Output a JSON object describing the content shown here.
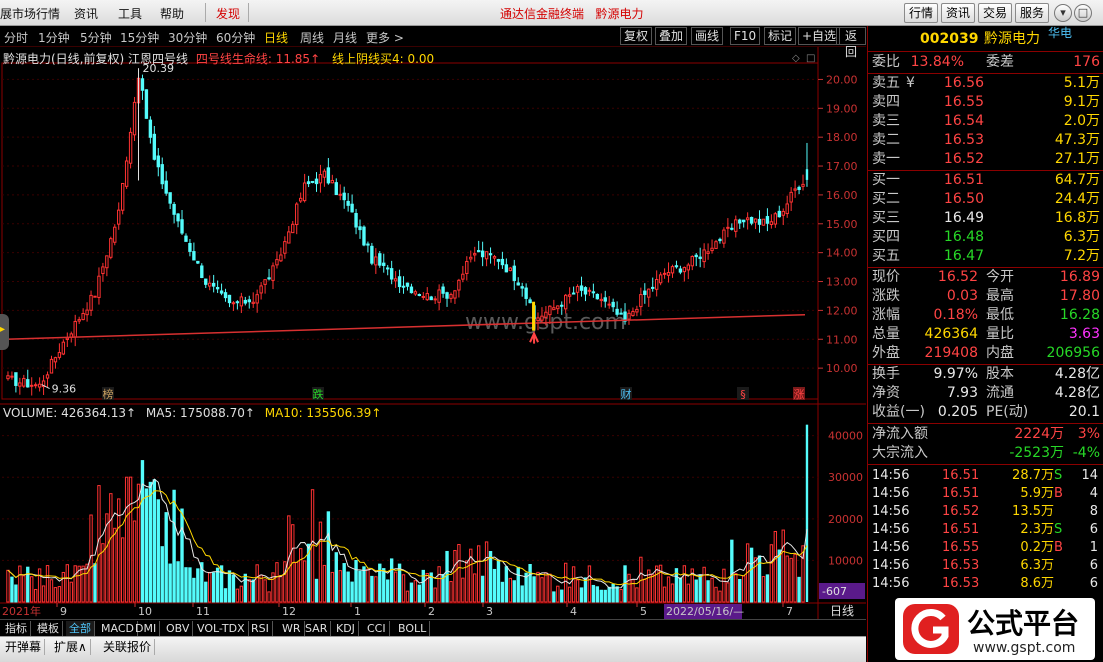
{
  "menu": {
    "items": [
      "展市场行情",
      "资讯",
      "工具",
      "帮助",
      "发现"
    ],
    "app_title": "通达信金融终端",
    "stock_title": "黔源电力",
    "right_buttons": [
      "行情",
      "资讯",
      "交易",
      "服务"
    ]
  },
  "periods": [
    "分时",
    "1分钟",
    "5分钟",
    "15分钟",
    "30分钟",
    "60分钟",
    "日线",
    "周线",
    "月线",
    "更多 >"
  ],
  "tools": [
    "复权",
    "叠加",
    "画线",
    "F10",
    "标记",
    "+自选",
    "返回"
  ],
  "main_info": {
    "title": "黔源电力(日线,前复权)",
    "indicator": "江恩四号线",
    "line1": "四号线生命线: 11.85↑",
    "line2": "线上阴线买4: 0.00"
  },
  "volume_info": {
    "vol": "VOLUME: 426364.13↑",
    "ma5": "MA5: 175088.70↑",
    "ma10": "MA10: 135506.39↑"
  },
  "price_axis": [
    "20.00",
    "19.00",
    "18.00",
    "17.00",
    "16.00",
    "15.00",
    "14.00",
    "13.00",
    "12.00",
    "11.00",
    "10.00"
  ],
  "volume_axis": [
    "40000",
    "30000",
    "20000",
    "10000"
  ],
  "annotations": {
    "high": "20.39",
    "low": "9.36",
    "events": [
      "榜",
      "跌",
      "财",
      "§",
      "涨"
    ],
    "watermark_text": "www.gspt.com"
  },
  "date_axis": {
    "labels": [
      "2021年",
      "9",
      "10",
      "11",
      "12",
      "1",
      "2",
      "3",
      "4",
      "5",
      "2022/05/16/—",
      "7"
    ],
    "period": "日线",
    "offset": "-607"
  },
  "chart_data": {
    "type": "candlestick",
    "ylim": [
      9.0,
      20.5
    ],
    "title": "黔源电力(日线,前复权)",
    "ma_line_name": "四号线生命线",
    "ma_line": {
      "start": 11.0,
      "end": 11.85
    },
    "high_mark": 20.39,
    "low_mark": 9.36,
    "volume_ylim": [
      0,
      44000
    ],
    "anchors": [
      [
        0,
        9.6
      ],
      [
        8,
        9.4
      ],
      [
        14,
        10.9
      ],
      [
        22,
        12.6
      ],
      [
        28,
        15.4
      ],
      [
        33,
        20.2
      ],
      [
        37,
        17.2
      ],
      [
        43,
        15.0
      ],
      [
        50,
        13.0
      ],
      [
        56,
        12.2
      ],
      [
        62,
        12.4
      ],
      [
        68,
        13.6
      ],
      [
        75,
        16.3
      ],
      [
        80,
        16.7
      ],
      [
        86,
        15.6
      ],
      [
        92,
        13.8
      ],
      [
        99,
        13.0
      ],
      [
        106,
        12.5
      ],
      [
        112,
        12.6
      ],
      [
        118,
        14.0
      ],
      [
        124,
        13.8
      ],
      [
        130,
        12.9
      ],
      [
        133,
        11.7
      ],
      [
        138,
        12.1
      ],
      [
        144,
        12.7
      ],
      [
        150,
        12.4
      ],
      [
        156,
        11.6
      ],
      [
        160,
        12.4
      ],
      [
        166,
        13.3
      ],
      [
        172,
        13.6
      ],
      [
        180,
        14.5
      ],
      [
        186,
        15.2
      ],
      [
        192,
        15.0
      ],
      [
        196,
        15.5
      ],
      [
        199,
        16.2
      ],
      [
        201,
        16.5
      ]
    ]
  },
  "quote": {
    "code": "002039",
    "name": "黔源电力",
    "tag": "华电",
    "weibi_label": "委比",
    "weibi": "13.84%",
    "weicha_label": "委差",
    "weicha": "176",
    "asks": [
      {
        "label": "卖五",
        "price": "16.56",
        "vol": "5.1万",
        "yen": "¥"
      },
      {
        "label": "卖四",
        "price": "16.55",
        "vol": "9.1万"
      },
      {
        "label": "卖三",
        "price": "16.54",
        "vol": "2.0万"
      },
      {
        "label": "卖二",
        "price": "16.53",
        "vol": "47.3万"
      },
      {
        "label": "卖一",
        "price": "16.52",
        "vol": "27.1万"
      }
    ],
    "bids": [
      {
        "label": "买一",
        "price": "16.51",
        "vol": "64.7万"
      },
      {
        "label": "买二",
        "price": "16.50",
        "vol": "24.4万"
      },
      {
        "label": "买三",
        "price": "16.49",
        "vol": "16.8万"
      },
      {
        "label": "买四",
        "price": "16.48",
        "vol": "6.3万"
      },
      {
        "label": "买五",
        "price": "16.47",
        "vol": "7.2万"
      }
    ],
    "stats": [
      {
        "l1": "现价",
        "v1": "16.52",
        "l2": "今开",
        "v2": "16.89"
      },
      {
        "l1": "涨跌",
        "v1": "0.03",
        "l2": "最高",
        "v2": "17.80"
      },
      {
        "l1": "涨幅",
        "v1": "0.18%",
        "l2": "最低",
        "v2": "16.28"
      },
      {
        "l1": "总量",
        "v1": "426364",
        "l2": "量比",
        "v2": "3.63"
      },
      {
        "l1": "外盘",
        "v1": "219408",
        "l2": "内盘",
        "v2": "206956"
      }
    ],
    "stats2": [
      {
        "l1": "换手",
        "v1": "9.97%",
        "l2": "股本",
        "v2": "4.28亿"
      },
      {
        "l1": "净资",
        "v1": "7.93",
        "l2": "流通",
        "v2": "4.28亿"
      },
      {
        "l1": "收益(一)",
        "v1": "0.205",
        "l2": "PE(动)",
        "v2": "20.1"
      }
    ],
    "flows": [
      {
        "label": "净流入额",
        "value": "2224万",
        "pct": "3%"
      },
      {
        "label": "大宗流入",
        "value": "-2523万",
        "pct": "-4%"
      }
    ],
    "ticks": [
      {
        "time": "14:56",
        "price": "16.51",
        "vol": "28.7万",
        "bs": "S",
        "n": "14"
      },
      {
        "time": "14:56",
        "price": "16.51",
        "vol": "5.9万",
        "bs": "B",
        "n": "4"
      },
      {
        "time": "14:56",
        "price": "16.52",
        "vol": "13.5万",
        "bs": "",
        "n": "8"
      },
      {
        "time": "14:56",
        "price": "16.51",
        "vol": "2.3万",
        "bs": "S",
        "n": "6"
      },
      {
        "time": "14:56",
        "price": "16.55",
        "vol": "0.2万",
        "bs": "B",
        "n": "1"
      },
      {
        "time": "14:56",
        "price": "16.53",
        "vol": "6.3万",
        "bs": "",
        "n": "6"
      },
      {
        "time": "14:56",
        "price": "16.53",
        "vol": "8.6万",
        "bs": "",
        "n": "6"
      }
    ]
  },
  "bottom_tabs": [
    "指标",
    "模板",
    "全部",
    "MACD",
    "DMI",
    "OBV",
    "VOL-TDX",
    "RSI",
    "WR",
    "SAR",
    "KDJ",
    "CCI",
    "BOLL"
  ],
  "bottom_tabs2": [
    "开弹幕",
    "扩展∧",
    "关联报价"
  ],
  "logo_text": "公式平台",
  "logo_url": "www.gspt.com"
}
